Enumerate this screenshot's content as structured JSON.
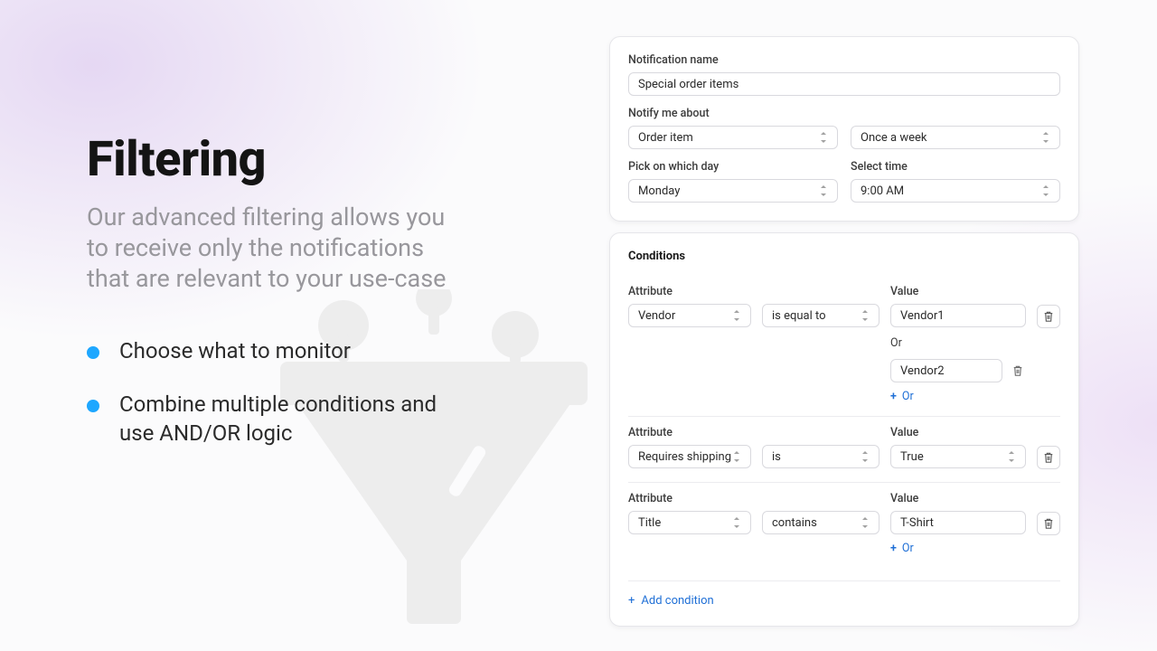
{
  "marketing": {
    "title": "Filtering",
    "subtitle": "Our advanced filtering allows you to receive only the notifications that are relevant to your use-case",
    "bullets": [
      "Choose what to monitor",
      "Combine multiple conditions and use AND/OR logic"
    ]
  },
  "form": {
    "name_label": "Notification name",
    "name_value": "Special order items",
    "about_label": "Notify me about",
    "about_value": "Order item",
    "freq_value": "Once a week",
    "day_label": "Pick on which day",
    "day_value": "Monday",
    "time_label": "Select time",
    "time_value": "9:00 AM"
  },
  "conditions": {
    "heading": "Conditions",
    "attr_label": "Attribute",
    "value_label": "Value",
    "or_label": "Or",
    "add_or_label": "Or",
    "add_condition_label": "Add condition",
    "rows": [
      {
        "attribute": "Vendor",
        "operator": "is equal to",
        "values": [
          "Vendor1",
          "Vendor2"
        ],
        "show_add_or": true
      },
      {
        "attribute": "Requires shipping",
        "operator": "is",
        "values": [
          "True"
        ],
        "show_add_or": false
      },
      {
        "attribute": "Title",
        "operator": "contains",
        "values": [
          "T-Shirt"
        ],
        "show_add_or": true
      }
    ]
  }
}
